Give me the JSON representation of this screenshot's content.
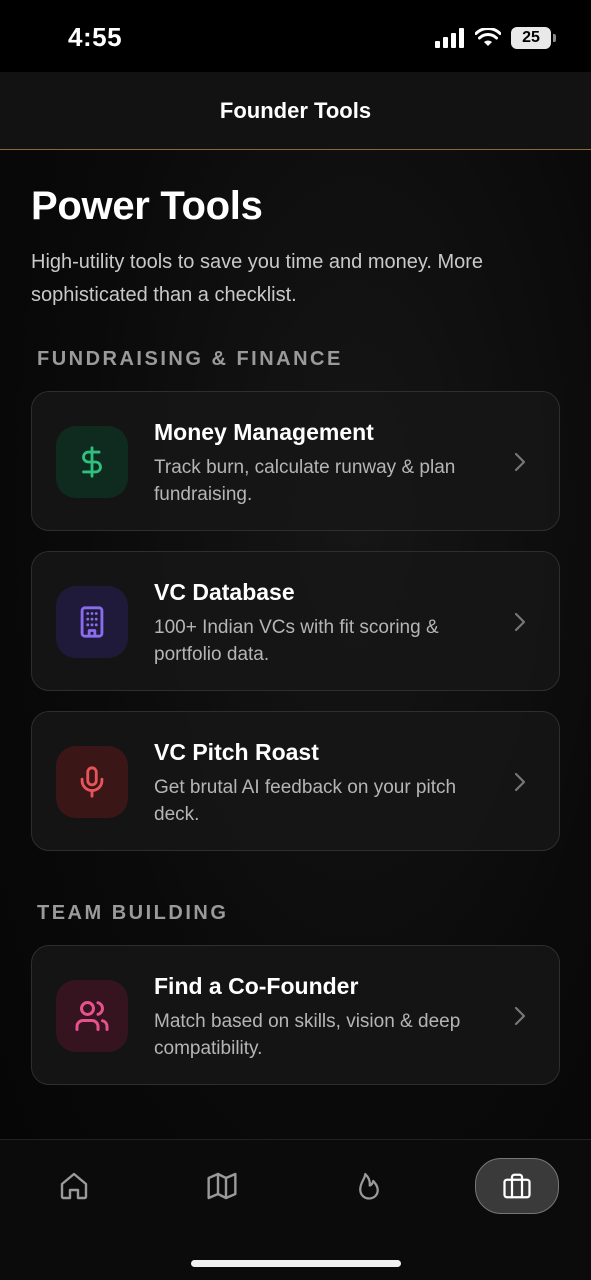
{
  "status_bar": {
    "time": "4:55",
    "battery": "25"
  },
  "nav": {
    "title": "Founder Tools"
  },
  "page": {
    "title": "Power Tools",
    "subtitle": "High-utility tools to save you time and money. More sophisticated than a checklist."
  },
  "sections": [
    {
      "header": "FUNDRAISING & FINANCE",
      "cards": [
        {
          "title": "Money Management",
          "description": "Track burn, calculate runway & plan fundraising.",
          "icon": "dollar-icon",
          "accent": "#2fc07e"
        },
        {
          "title": "VC Database",
          "description": "100+ Indian VCs with fit scoring & portfolio data.",
          "icon": "building-icon",
          "accent": "#8b6cf0"
        },
        {
          "title": "VC Pitch Roast",
          "description": "Get brutal AI feedback on your pitch deck.",
          "icon": "microphone-icon",
          "accent": "#e8545a"
        }
      ]
    },
    {
      "header": "TEAM BUILDING",
      "cards": [
        {
          "title": "Find a Co-Founder",
          "description": "Match based on skills, vision & deep compatibility.",
          "icon": "users-icon",
          "accent": "#e8508e"
        }
      ]
    }
  ],
  "tab_bar": {
    "tabs": [
      {
        "icon": "home-icon",
        "active": false
      },
      {
        "icon": "map-icon",
        "active": false
      },
      {
        "icon": "flame-icon",
        "active": false
      },
      {
        "icon": "briefcase-icon",
        "active": true
      }
    ]
  },
  "colors": {
    "nav_border": "#8a6a3a",
    "section_header": "#9a9a9a"
  }
}
